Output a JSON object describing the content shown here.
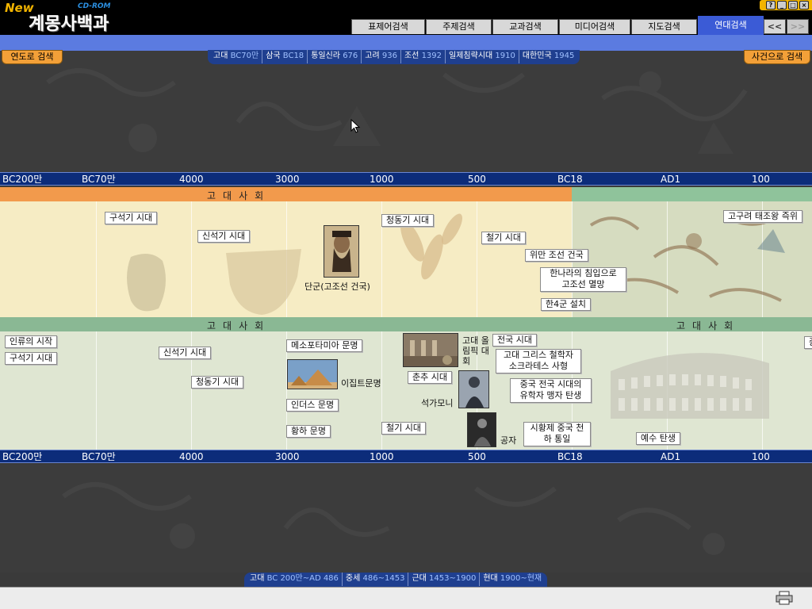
{
  "app": {
    "logo_new": "New",
    "logo_cdrom": "CD-ROM",
    "logo_title": "계몽사백과"
  },
  "window_controls": [
    "?",
    "_",
    "□",
    "×"
  ],
  "tabs": [
    {
      "label": "표제어검색",
      "active": false
    },
    {
      "label": "주제검색",
      "active": false
    },
    {
      "label": "교과검색",
      "active": false
    },
    {
      "label": "미디어검색",
      "active": false
    },
    {
      "label": "지도검색",
      "active": false
    },
    {
      "label": "연대검색",
      "active": true
    }
  ],
  "nav": {
    "prev": "<<",
    "next": ">>"
  },
  "left_button": "연도로 검색",
  "right_button": "사건으로 검색",
  "era_bar": [
    {
      "name": "고대",
      "year": "BC70만"
    },
    {
      "name": "삼국",
      "year": "BC18"
    },
    {
      "name": "통일신라",
      "year": "676"
    },
    {
      "name": "고려",
      "year": "936"
    },
    {
      "name": "조선",
      "year": "1392"
    },
    {
      "name": "일제침략시대",
      "year": "1910"
    },
    {
      "name": "대한민국",
      "year": "1945"
    }
  ],
  "scale_labels": [
    "BC200만",
    "BC70만",
    "4000",
    "3000",
    "1000",
    "500",
    "BC18",
    "AD1",
    "100"
  ],
  "korea_band": {
    "title": "고대사회",
    "events": [
      {
        "id": "kr-paleo",
        "label": "구석기 시대"
      },
      {
        "id": "kr-neo",
        "label": "신석기 시대"
      },
      {
        "id": "kr-dangun",
        "label": "단군(고조선 건국)"
      },
      {
        "id": "kr-bronze",
        "label": "청동기 시대"
      },
      {
        "id": "kr-iron",
        "label": "철기 시대"
      },
      {
        "id": "kr-wiman",
        "label": "위만 조선 건국"
      },
      {
        "id": "kr-fall",
        "label": "한나라의 침입으로 고조선 멸망"
      },
      {
        "id": "kr-4gun",
        "label": "한4군 설치"
      },
      {
        "id": "kr-goguryeo",
        "label": "고구려 태조왕 즉위"
      }
    ]
  },
  "world_band": {
    "title": "고대사회",
    "events": [
      {
        "id": "w-origin",
        "label": "인류의 시작"
      },
      {
        "id": "w-paleo",
        "label": "구석기 시대"
      },
      {
        "id": "w-neo",
        "label": "신석기 시대"
      },
      {
        "id": "w-bronze",
        "label": "청동기 시대"
      },
      {
        "id": "w-meso",
        "label": "메소포타미아 문명"
      },
      {
        "id": "w-egypt",
        "label": "이집트문명"
      },
      {
        "id": "w-indus",
        "label": "인더스 문명"
      },
      {
        "id": "w-huangho",
        "label": "황하 문명"
      },
      {
        "id": "w-iron",
        "label": "철기 시대"
      },
      {
        "id": "w-olympic",
        "label": "고대 올림픽 대회"
      },
      {
        "id": "w-chunqiu",
        "label": "춘추 시대"
      },
      {
        "id": "w-buddha",
        "label": "석가모니"
      },
      {
        "id": "w-confucius",
        "label": "공자"
      },
      {
        "id": "w-warring",
        "label": "전국 시대"
      },
      {
        "id": "w-socrates",
        "label": "고대 그리스 철학자 소크라테스 사형"
      },
      {
        "id": "w-mencius",
        "label": "중국 전국 시대의 유학자 맹자 탄생"
      },
      {
        "id": "w-qin",
        "label": "시황제 중국 천하 통일"
      },
      {
        "id": "w-jesus",
        "label": "예수 탄생"
      },
      {
        "id": "w-partial",
        "label": "중"
      }
    ]
  },
  "bottom_bar": [
    {
      "name": "고대",
      "year": "BC 200만~AD 486"
    },
    {
      "name": "중세",
      "year": "486~1453"
    },
    {
      "name": "근대",
      "year": "1453~1900"
    },
    {
      "name": "현대",
      "year": "1900~현재"
    }
  ],
  "colors": {
    "korea_header": "#f29a4c",
    "world_header": "#8ab894",
    "scale": "#0c2c7a",
    "active_tab": "#3b5bd6"
  },
  "icons": [
    "printer-icon",
    "cursor-pointer-icon"
  ]
}
